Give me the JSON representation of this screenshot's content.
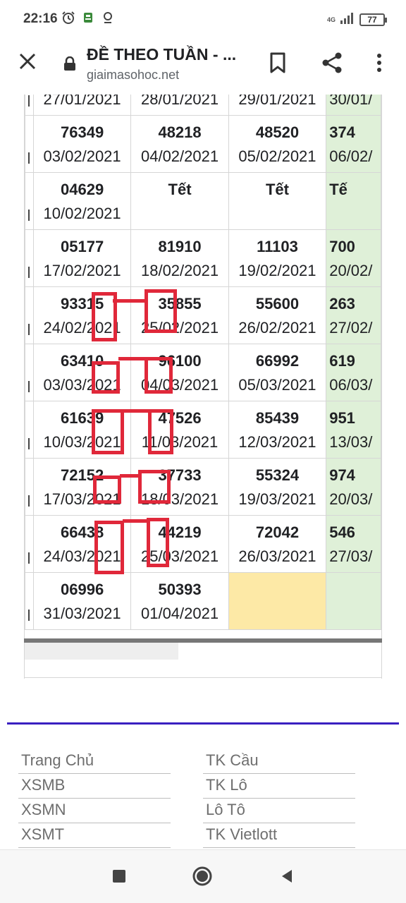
{
  "status_bar": {
    "time": "22:16",
    "network": "4G",
    "battery": "77",
    "icons": [
      "alarm-icon",
      "app-notification-icon",
      "location-icon"
    ]
  },
  "toolbar": {
    "title": "ĐỀ THEO TUẦN - ...",
    "url": "giaimasohoc.net",
    "close_icon": "close-icon",
    "lock_icon": "lock-icon",
    "bookmark_icon": "bookmark-icon",
    "share_icon": "share-icon",
    "more_icon": "more-vert-icon"
  },
  "table": {
    "rows": [
      {
        "cells": [
          {
            "num": "",
            "date": "27/01/2021"
          },
          {
            "num": "",
            "date": "28/01/2021"
          },
          {
            "num": "",
            "date": "29/01/2021"
          },
          {
            "num": "",
            "date": "30/01/"
          }
        ]
      },
      {
        "cells": [
          {
            "num": "76349",
            "date": "03/02/2021"
          },
          {
            "num": "48218",
            "date": "04/02/2021"
          },
          {
            "num": "48520",
            "date": "05/02/2021"
          },
          {
            "num": "374",
            "date": "06/02/"
          }
        ]
      },
      {
        "cells": [
          {
            "num": "04629",
            "date": "10/02/2021"
          },
          {
            "num": "Tết",
            "date": ""
          },
          {
            "num": "Tết",
            "date": ""
          },
          {
            "num": "Tế",
            "date": ""
          }
        ]
      },
      {
        "cells": [
          {
            "num": "05177",
            "date": "17/02/2021"
          },
          {
            "num": "81910",
            "date": "18/02/2021"
          },
          {
            "num": "11103",
            "date": "19/02/2021"
          },
          {
            "num": "700",
            "date": "20/02/"
          }
        ]
      },
      {
        "cells": [
          {
            "num": "93315",
            "date": "24/02/2021"
          },
          {
            "num": "35855",
            "date": "25/02/2021"
          },
          {
            "num": "55600",
            "date": "26/02/2021"
          },
          {
            "num": "263",
            "date": "27/02/"
          }
        ]
      },
      {
        "cells": [
          {
            "num": "63410",
            "date": "03/03/2021"
          },
          {
            "num": "96100",
            "date": "04/03/2021"
          },
          {
            "num": "66992",
            "date": "05/03/2021"
          },
          {
            "num": "619",
            "date": "06/03/"
          }
        ]
      },
      {
        "cells": [
          {
            "num": "61639",
            "date": "10/03/2021"
          },
          {
            "num": "47526",
            "date": "11/03/2021"
          },
          {
            "num": "85439",
            "date": "12/03/2021"
          },
          {
            "num": "951",
            "date": "13/03/"
          }
        ]
      },
      {
        "cells": [
          {
            "num": "72152",
            "date": "17/03/2021"
          },
          {
            "num": "37733",
            "date": "18/03/2021"
          },
          {
            "num": "55324",
            "date": "19/03/2021"
          },
          {
            "num": "974",
            "date": "20/03/"
          }
        ]
      },
      {
        "cells": [
          {
            "num": "66438",
            "date": "24/03/2021"
          },
          {
            "num": "44219",
            "date": "25/03/2021"
          },
          {
            "num": "72042",
            "date": "26/03/2021"
          },
          {
            "num": "546",
            "date": "27/03/"
          }
        ]
      },
      {
        "cells": [
          {
            "num": "06996",
            "date": "31/03/2021"
          },
          {
            "num": "50393",
            "date": "01/04/2021"
          },
          {
            "num": "",
            "date": ""
          },
          {
            "num": "",
            "date": ""
          }
        ]
      }
    ]
  },
  "footer": {
    "links_left": [
      "Trang Chủ",
      "XSMB",
      "XSMN",
      "XSMT"
    ],
    "links_right": [
      "TK Cầu",
      "TK Lô",
      "Lô Tô",
      "TK Vietlott"
    ]
  },
  "colors": {
    "weekend_column": "#dff0d8",
    "today_cell": "#fde9a6",
    "annotation": "#e0283a",
    "divider": "#3a1fc0"
  },
  "navbar": {
    "buttons": [
      "recents-icon",
      "home-icon",
      "back-icon"
    ]
  }
}
